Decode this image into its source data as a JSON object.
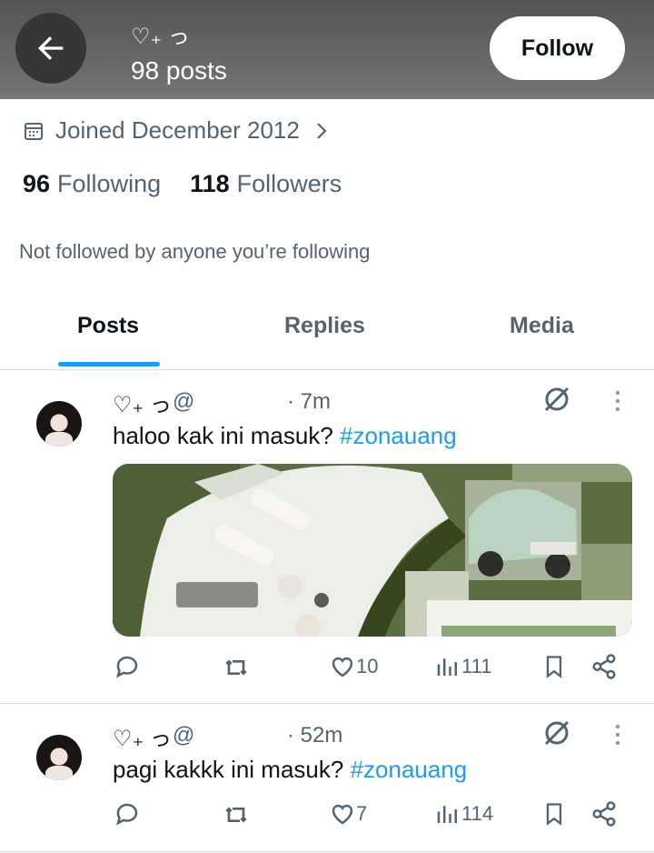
{
  "header": {
    "name": "♡₊ っ",
    "posts_count": "98 posts",
    "follow_label": "Follow"
  },
  "profile": {
    "joined": "Joined December 2012",
    "following_count": "96",
    "following_label": "Following",
    "followers_count": "118",
    "followers_label": "Followers",
    "not_followed_text": "Not followed by anyone you’re following"
  },
  "tabs": [
    {
      "label": "Posts",
      "active": true
    },
    {
      "label": "Replies",
      "active": false
    },
    {
      "label": "Media",
      "active": false
    }
  ],
  "tweets": [
    {
      "name": "♡₊ っ",
      "handle": "@",
      "time": "· 7m",
      "text": "haloo kak ini masuk? ",
      "hashtag": "#zonauang",
      "likes": "10",
      "views": "111"
    },
    {
      "name": "♡₊ っ",
      "handle": "@",
      "time": "· 52m",
      "text": "pagi kakkk ini masuk? ",
      "hashtag": "#zonauang",
      "likes": "7",
      "views": "114"
    }
  ],
  "colors": {
    "accent": "#1d9bf0",
    "secondary_text": "#536471",
    "header_bg": "#5e5e5e"
  }
}
